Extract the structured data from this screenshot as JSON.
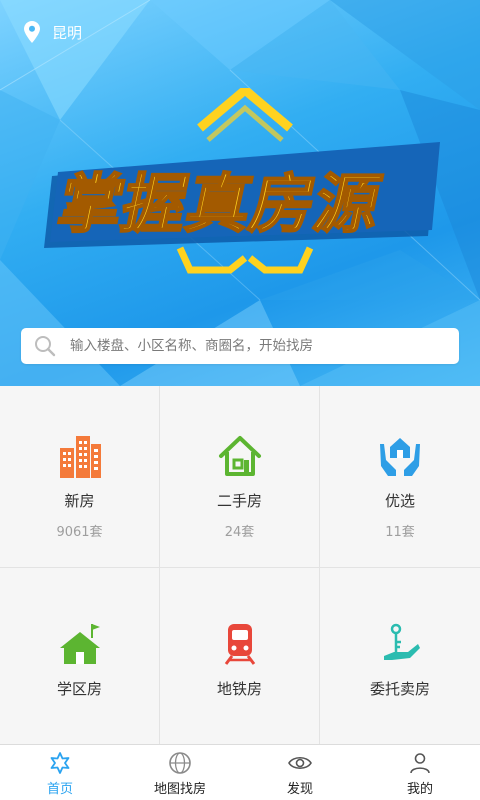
{
  "header": {
    "city": "昆明"
  },
  "banner": {
    "slogan": "掌握真房源"
  },
  "search": {
    "placeholder": "输入楼盘、小区名称、商圈名，开始找房"
  },
  "categories": [
    {
      "label": "新房",
      "count": "9061套",
      "icon": "buildings-icon",
      "color": "#f47a3a"
    },
    {
      "label": "二手房",
      "count": "24套",
      "icon": "house-icon",
      "color": "#5cb531"
    },
    {
      "label": "优选",
      "count": "11套",
      "icon": "hands-house-icon",
      "color": "#2e9ee6"
    },
    {
      "label": "学区房",
      "icon": "school-house-icon",
      "color": "#5cb531"
    },
    {
      "label": "地铁房",
      "icon": "subway-icon",
      "color": "#e8473a"
    },
    {
      "label": "委托卖房",
      "icon": "key-hand-icon",
      "color": "#2bbcb0"
    }
  ],
  "tabs": [
    {
      "label": "首页",
      "icon": "home-flower-icon",
      "active": true
    },
    {
      "label": "地图找房",
      "icon": "globe-icon",
      "active": false
    },
    {
      "label": "发现",
      "icon": "eye-icon",
      "active": false
    },
    {
      "label": "我的",
      "icon": "person-icon",
      "active": false
    }
  ],
  "colors": {
    "accent": "#2aa3f0",
    "banner_blue": "#32aef2",
    "slogan_yellow": "#ffd21f"
  }
}
